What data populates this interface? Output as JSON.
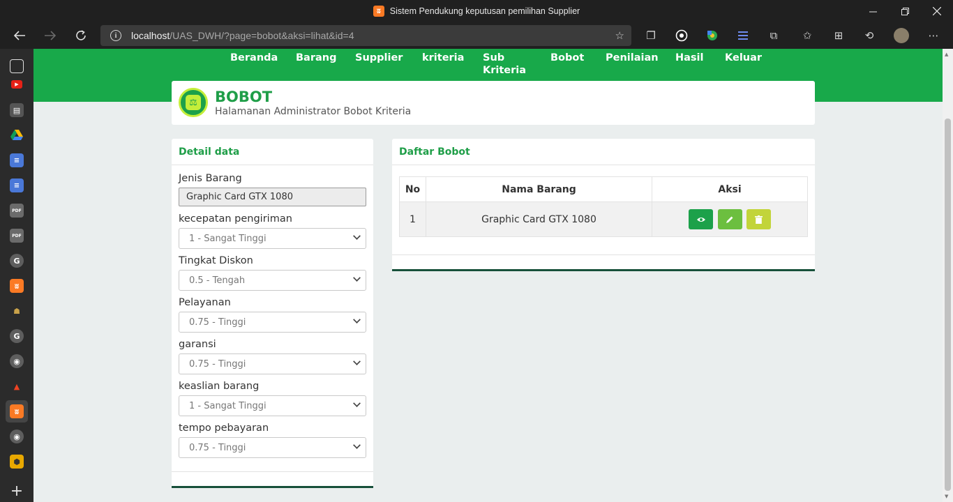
{
  "window": {
    "title": "Sistem Pendukung keputusan pemilihan Supplier",
    "app_icon": "xampp-icon",
    "controls": [
      "minimize",
      "restore",
      "close"
    ]
  },
  "browser": {
    "url_host": "localhost",
    "url_path": "/UAS_DWH/?page=bobot&aksi=lihat&id=4",
    "toolbar_icons": [
      "favorites-add-icon",
      "collections-icon",
      "whatsapp-icon",
      "google-lens-icon",
      "reading-list-icon",
      "extensions-icon",
      "favorites-icon",
      "tab-actions-icon",
      "history-icon",
      "profile-avatar",
      "more-icon"
    ],
    "sidebar_icons": [
      "tab-actions-icon",
      "youtube-icon",
      "page-icon",
      "google-drive-icon",
      "docs-icon",
      "docs-icon",
      "pdf-icon",
      "pdf-icon",
      "google-icon",
      "xampp-icon",
      "app-icon",
      "google-icon",
      "github-icon",
      "codeigniter-icon",
      "xampp-icon",
      "github-icon",
      "app-icon",
      "add-icon"
    ]
  },
  "nav": {
    "items": [
      "Beranda",
      "Barang",
      "Supplier",
      "kriteria",
      "Sub Kriteria",
      "Bobot",
      "Penilaian",
      "Hasil",
      "Keluar"
    ]
  },
  "header": {
    "title": "BOBOT",
    "subtitle": "Halamanan Administrator Bobot Kriteria",
    "icon": "scale-icon"
  },
  "detail": {
    "heading": "Detail data",
    "jenis_label": "Jenis Barang",
    "jenis_value": "Graphic Card GTX 1080",
    "fields": [
      {
        "label": "kecepatan pengiriman",
        "value": "1 - Sangat Tinggi"
      },
      {
        "label": "Tingkat Diskon",
        "value": "0.5 - Tengah"
      },
      {
        "label": "Pelayanan",
        "value": "0.75 - Tinggi"
      },
      {
        "label": "garansi",
        "value": "0.75 - Tinggi"
      },
      {
        "label": "keaslian barang",
        "value": "1 - Sangat Tinggi"
      },
      {
        "label": "tempo pebayaran",
        "value": "0.75 - Tinggi"
      }
    ]
  },
  "daftar": {
    "heading": "Daftar Bobot",
    "columns": [
      "No",
      "Nama Barang",
      "Aksi"
    ],
    "rows": [
      {
        "no": "1",
        "nama": "Graphic Card GTX 1080",
        "actions": [
          "eye-icon",
          "pencil-icon",
          "trash-icon"
        ]
      }
    ],
    "action_colors": {
      "view": "#1ca14a",
      "edit": "#6cbf3f",
      "delete": "#c2d43a"
    }
  },
  "colors": {
    "nav_green": "#18a94a",
    "title_green": "#1f9e48",
    "page_bg": "#eaeeee",
    "card_bottom": "#17503a"
  }
}
